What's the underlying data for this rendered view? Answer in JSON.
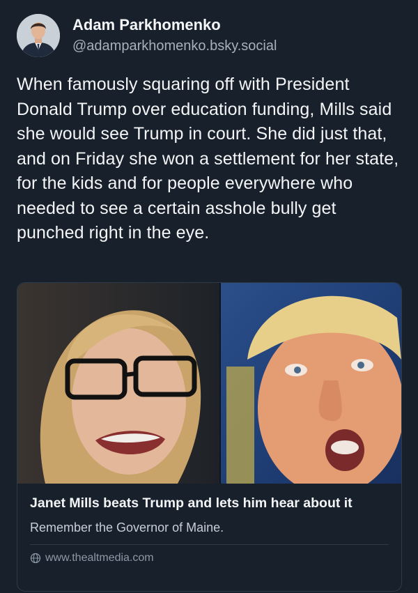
{
  "author": {
    "display_name": "Adam Parkhomenko",
    "handle": "@adamparkhomenko.bsky.social",
    "avatar_icon": "user-portrait"
  },
  "post": {
    "text": "When famously squaring off with President Donald Trump over education funding, Mills said she would see Trump in court. She did just that, and on Friday she won a settlement for her state, for the kids and for people everywhere who needed to see a certain asshole bully get punched right in the eye."
  },
  "link_card": {
    "title": "Janet Mills beats Trump and lets him hear about it",
    "description": "Remember the Governor of Maine.",
    "domain": "www.thealtmedia.com",
    "domain_icon": "globe-icon"
  },
  "colors": {
    "background": "#17202b",
    "card_border": "#2d3a4a",
    "secondary_text": "#a7b0bc"
  }
}
